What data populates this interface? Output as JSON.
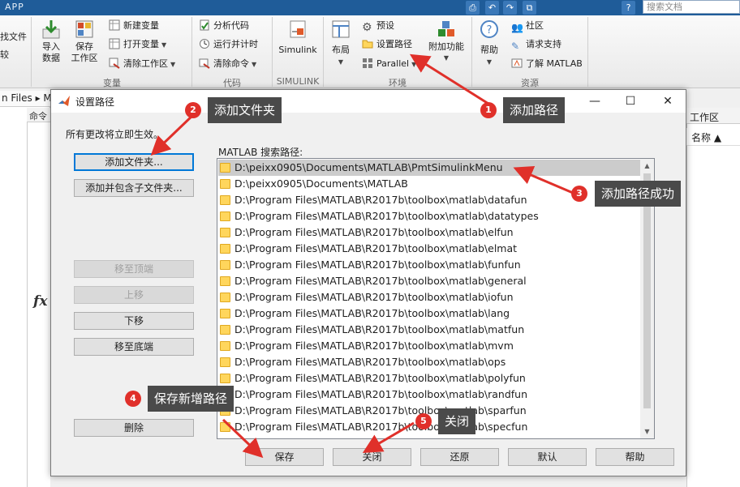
{
  "topbar": {
    "app_tab": "APP",
    "search_placeholder": "搜索文档"
  },
  "ribbon": {
    "partial_left": [
      "找文件",
      "较"
    ],
    "import_data": "导入\n数据",
    "save_workspace": "保存\n工作区",
    "new_variable": "新建变量",
    "open_variable": "打开变量",
    "clear_workspace": "清除工作区",
    "analyze_code": "分析代码",
    "run_and_time": "运行并计时",
    "clear_commands": "清除命令",
    "simulink": "Simulink",
    "layout": "布局",
    "preferences": "预设",
    "set_path": "设置路径",
    "parallel": "Parallel",
    "addons": "附加功能",
    "help": "帮助",
    "community": "社区",
    "request_support": "请求支持",
    "learn_matlab": "了解 MATLAB",
    "sections": {
      "variable": "变量",
      "code": "代码",
      "simulink": "SIMULINK",
      "environment": "环境",
      "resources": "资源"
    }
  },
  "background": {
    "address_text": "n Files ▸ M",
    "command_header": "命令",
    "fx": "fx",
    "workspace_title": "工作区",
    "workspace_column": "名称 ▲"
  },
  "dialog": {
    "title": "设置路径",
    "note": "所有更改将立即生效。",
    "left_buttons": {
      "add_folder": "添加文件夹...",
      "add_with_subfolders": "添加并包含子文件夹...",
      "move_top": "移至顶端",
      "move_up": "上移",
      "move_down": "下移",
      "move_bottom": "移至底端",
      "remove": "删除"
    },
    "path_label": "MATLAB 搜索路径:",
    "paths": [
      "D:\\peixx0905\\Documents\\MATLAB\\PmtSimulinkMenu",
      "D:\\peixx0905\\Documents\\MATLAB",
      "D:\\Program Files\\MATLAB\\R2017b\\toolbox\\matlab\\datafun",
      "D:\\Program Files\\MATLAB\\R2017b\\toolbox\\matlab\\datatypes",
      "D:\\Program Files\\MATLAB\\R2017b\\toolbox\\matlab\\elfun",
      "D:\\Program Files\\MATLAB\\R2017b\\toolbox\\matlab\\elmat",
      "D:\\Program Files\\MATLAB\\R2017b\\toolbox\\matlab\\funfun",
      "D:\\Program Files\\MATLAB\\R2017b\\toolbox\\matlab\\general",
      "D:\\Program Files\\MATLAB\\R2017b\\toolbox\\matlab\\iofun",
      "D:\\Program Files\\MATLAB\\R2017b\\toolbox\\matlab\\lang",
      "D:\\Program Files\\MATLAB\\R2017b\\toolbox\\matlab\\matfun",
      "D:\\Program Files\\MATLAB\\R2017b\\toolbox\\matlab\\mvm",
      "D:\\Program Files\\MATLAB\\R2017b\\toolbox\\matlab\\ops",
      "D:\\Program Files\\MATLAB\\R2017b\\toolbox\\matlab\\polyfun",
      "D:\\Program Files\\MATLAB\\R2017b\\toolbox\\matlab\\randfun",
      "D:\\Program Files\\MATLAB\\R2017b\\toolbox\\matlab\\sparfun",
      "D:\\Program Files\\MATLAB\\R2017b\\toolbox\\matlab\\specfun"
    ],
    "bottom_buttons": {
      "save": "保存",
      "close": "关闭",
      "revert": "还原",
      "default": "默认",
      "help": "帮助"
    }
  },
  "annotations": [
    {
      "num": "1",
      "text": "添加路径"
    },
    {
      "num": "2",
      "text": "添加文件夹"
    },
    {
      "num": "3",
      "text": "添加路径成功"
    },
    {
      "num": "4",
      "text": "保存新增路径"
    },
    {
      "num": "5",
      "text": "关闭"
    }
  ],
  "colors": {
    "annotation_red": "#e0302a",
    "label_bg": "#4a4a4a",
    "ribbon_top": "#1f5c99",
    "focus_blue": "#0078d7"
  }
}
